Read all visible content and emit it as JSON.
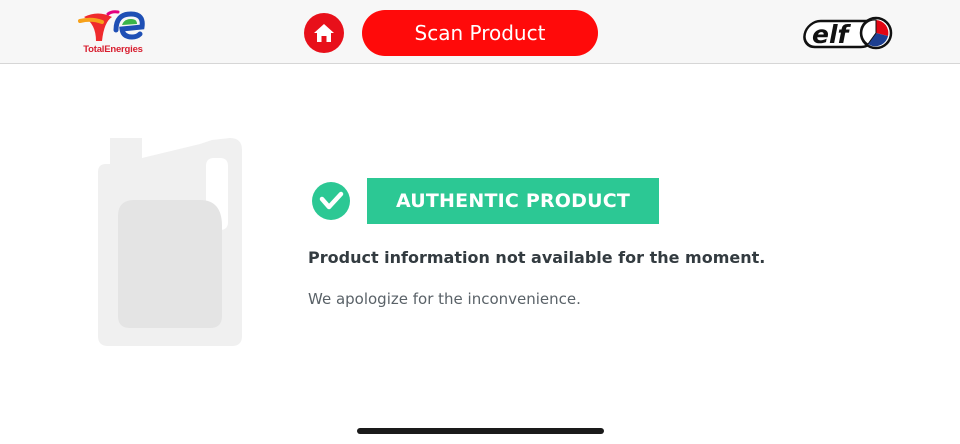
{
  "header": {
    "total_logo_text": "TotalEnergies",
    "elf_logo_text": "elf",
    "home_icon": "home-icon",
    "scan_label": "Scan Product"
  },
  "result": {
    "status_icon": "check-circle-icon",
    "status_label": "AUTHENTIC PRODUCT",
    "info_message": "Product information not available for the moment.",
    "apology_message": "We apologize for the inconvenience."
  },
  "product_image": {
    "icon": "oil-jerrycan-placeholder-icon"
  },
  "colors": {
    "brand_red": "#ff0a0a",
    "authentic_green": "#2cc894",
    "header_bg": "#f7f7f7",
    "placeholder_gray": "#eeeeee"
  }
}
